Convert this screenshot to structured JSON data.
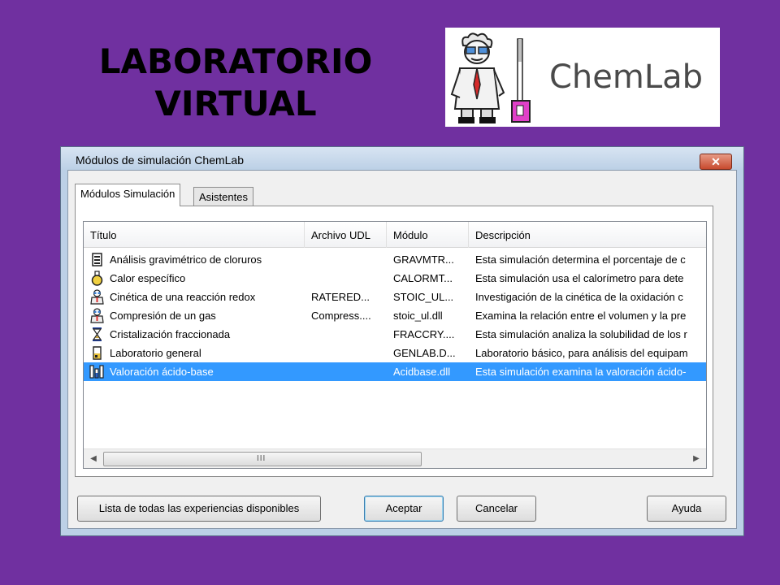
{
  "slide": {
    "title_line1": "LABORATORIO",
    "title_line2": "VIRTUAL",
    "logo_text": "ChemLab"
  },
  "window": {
    "title": "Módulos de simulación ChemLab",
    "close_label": "✕"
  },
  "tabs": [
    {
      "label": "Módulos Simulación",
      "active": true
    },
    {
      "label": "Asistentes",
      "active": false
    }
  ],
  "table": {
    "columns": [
      "Título",
      "Archivo UDL",
      "Módulo",
      "Descripción"
    ],
    "rows": [
      {
        "icon": "beaker-icon",
        "title": "Análisis gravimétrico de cloruros",
        "udl": "",
        "module": "GRAVMTR...",
        "description": "Esta simulación determina el porcentaje de c"
      },
      {
        "icon": "flask-icon",
        "title": "Calor específico",
        "udl": "",
        "module": "CALORMT...",
        "description": "Esta simulación usa el calorímetro para dete"
      },
      {
        "icon": "scientist-icon",
        "title": "Cinética de una reacción redox",
        "udl": "RATERED...",
        "module": "STOIC_UL...",
        "description": "Investigación de la cinética de la oxidación c"
      },
      {
        "icon": "scientist-icon",
        "title": "Compresión de un gas",
        "udl": "Compress....",
        "module": "stoic_ul.dll",
        "description": "Examina la relación entre el volumen y la pre"
      },
      {
        "icon": "hourglass-icon",
        "title": "Cristalización fraccionada",
        "udl": "",
        "module": "FRACCRY....",
        "description": "Esta simulación analiza la solubilidad de los r"
      },
      {
        "icon": "beaker-icon",
        "title": "Laboratorio general",
        "udl": "",
        "module": "GENLAB.D...",
        "description": "Laboratorio básico, para análisis del equipam"
      },
      {
        "icon": "titration-icon",
        "title": "Valoración ácido-base",
        "udl": "",
        "module": "Acidbase.dll",
        "description": "Esta simulación examina la valoración ácido-",
        "selected": true
      }
    ]
  },
  "scrollbar": {
    "left_arrow": "◀",
    "right_arrow": "▶",
    "grip": "III"
  },
  "buttons": {
    "list_all": "Lista de todas las experiencias disponibles",
    "accept": "Aceptar",
    "cancel": "Cancelar",
    "help": "Ayuda"
  },
  "colors": {
    "background": "#7030a0",
    "selection": "#3399ff"
  }
}
